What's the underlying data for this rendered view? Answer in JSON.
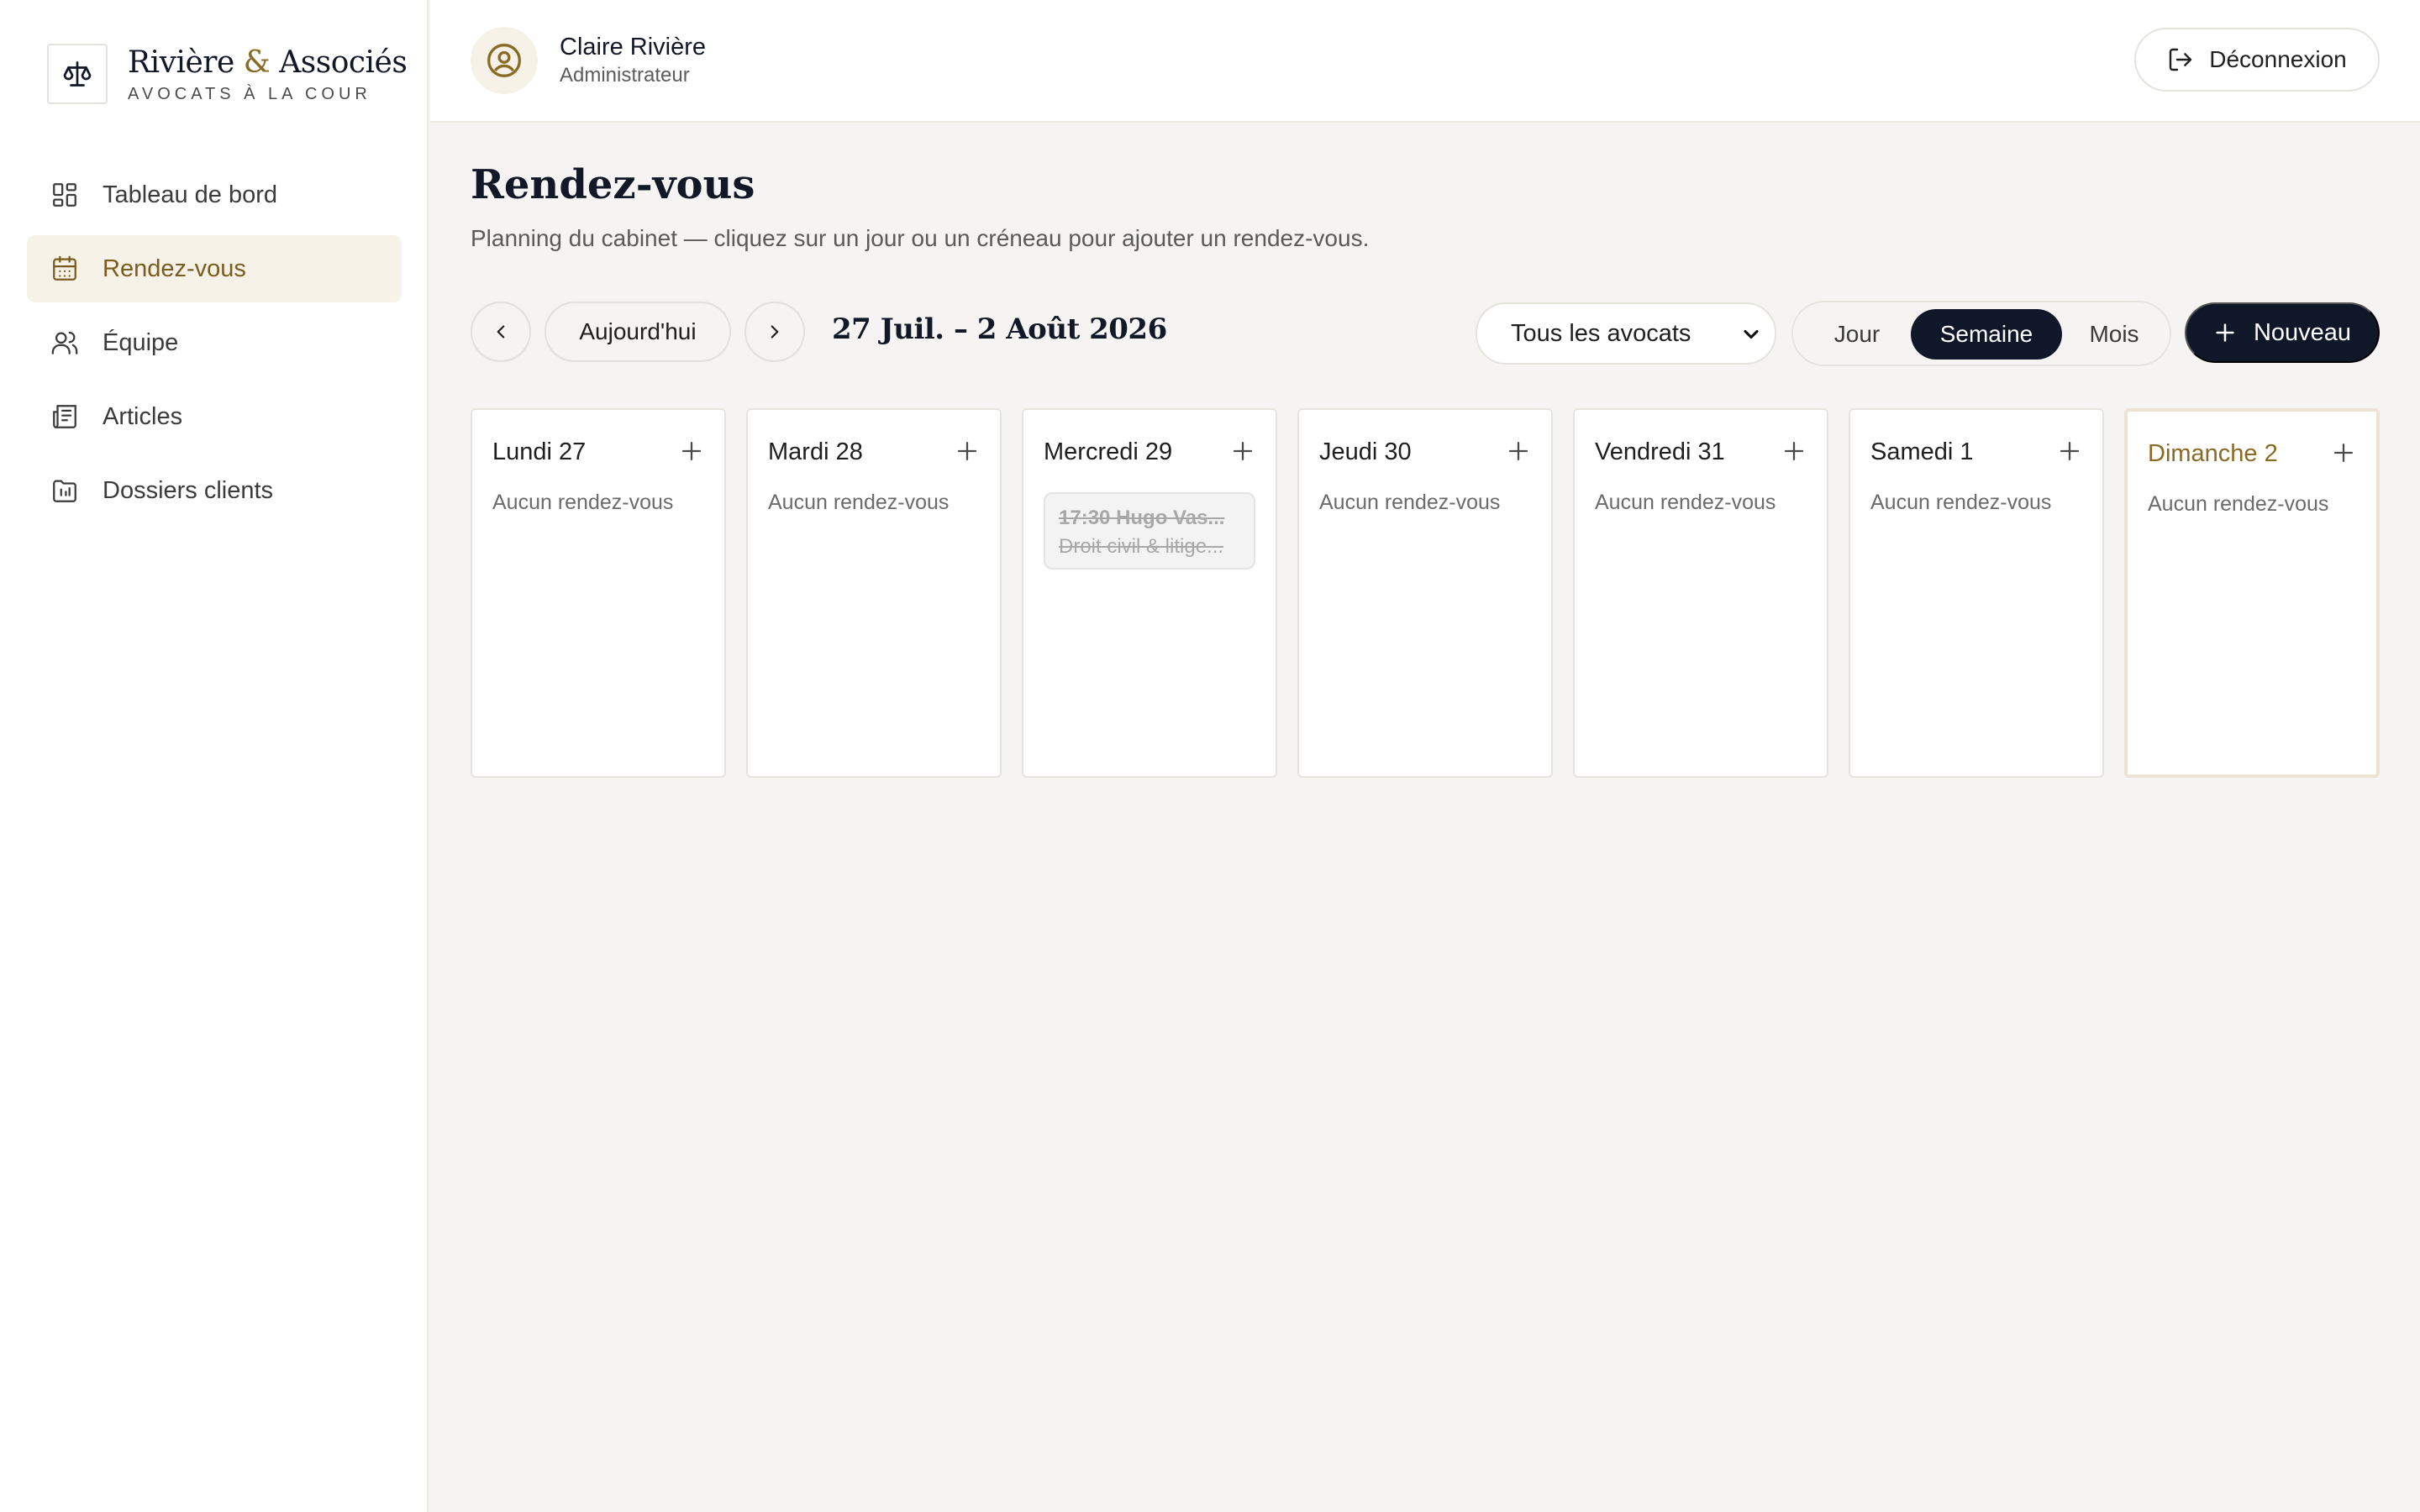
{
  "brand": {
    "name_part1": "Rivière",
    "amp": "&",
    "name_part2": "Associés",
    "tagline": "AVOCATS À LA COUR",
    "logo_icon": "scales-icon"
  },
  "sidebar": {
    "items": [
      {
        "label": "Tableau de bord",
        "icon": "dashboard-icon",
        "active": false
      },
      {
        "label": "Rendez-vous",
        "icon": "calendar-icon",
        "active": true
      },
      {
        "label": "Équipe",
        "icon": "users-icon",
        "active": false
      },
      {
        "label": "Articles",
        "icon": "newspaper-icon",
        "active": false
      },
      {
        "label": "Dossiers clients",
        "icon": "folder-icon",
        "active": false
      }
    ]
  },
  "header": {
    "user_name": "Claire Rivière",
    "user_role": "Administrateur",
    "logout_label": "Déconnexion"
  },
  "page": {
    "title": "Rendez-vous",
    "subtitle": "Planning du cabinet — cliquez sur un jour ou un créneau pour ajouter un rendez-vous."
  },
  "toolbar": {
    "today_label": "Aujourd'hui",
    "range_label": "27 Juil. – 2 Août 2026",
    "lawyer_filter": "Tous les avocats",
    "views": [
      "Jour",
      "Semaine",
      "Mois"
    ],
    "active_view": "Semaine",
    "new_label": "Nouveau"
  },
  "week": {
    "empty_label": "Aucun rendez-vous",
    "days": [
      {
        "label": "Lundi 27"
      },
      {
        "label": "Mardi 28"
      },
      {
        "label": "Mercredi 29",
        "appointment": {
          "time": "17:30",
          "name": "Hugo Vas...",
          "topic": "Droit civil & litige..."
        }
      },
      {
        "label": "Jeudi 30"
      },
      {
        "label": "Vendredi 31"
      },
      {
        "label": "Samedi 1"
      },
      {
        "label": "Dimanche 2",
        "today": true
      }
    ]
  },
  "colors": {
    "accent_gold": "#8a6a24",
    "navy": "#0f1729",
    "background": "#f5f4f2"
  }
}
